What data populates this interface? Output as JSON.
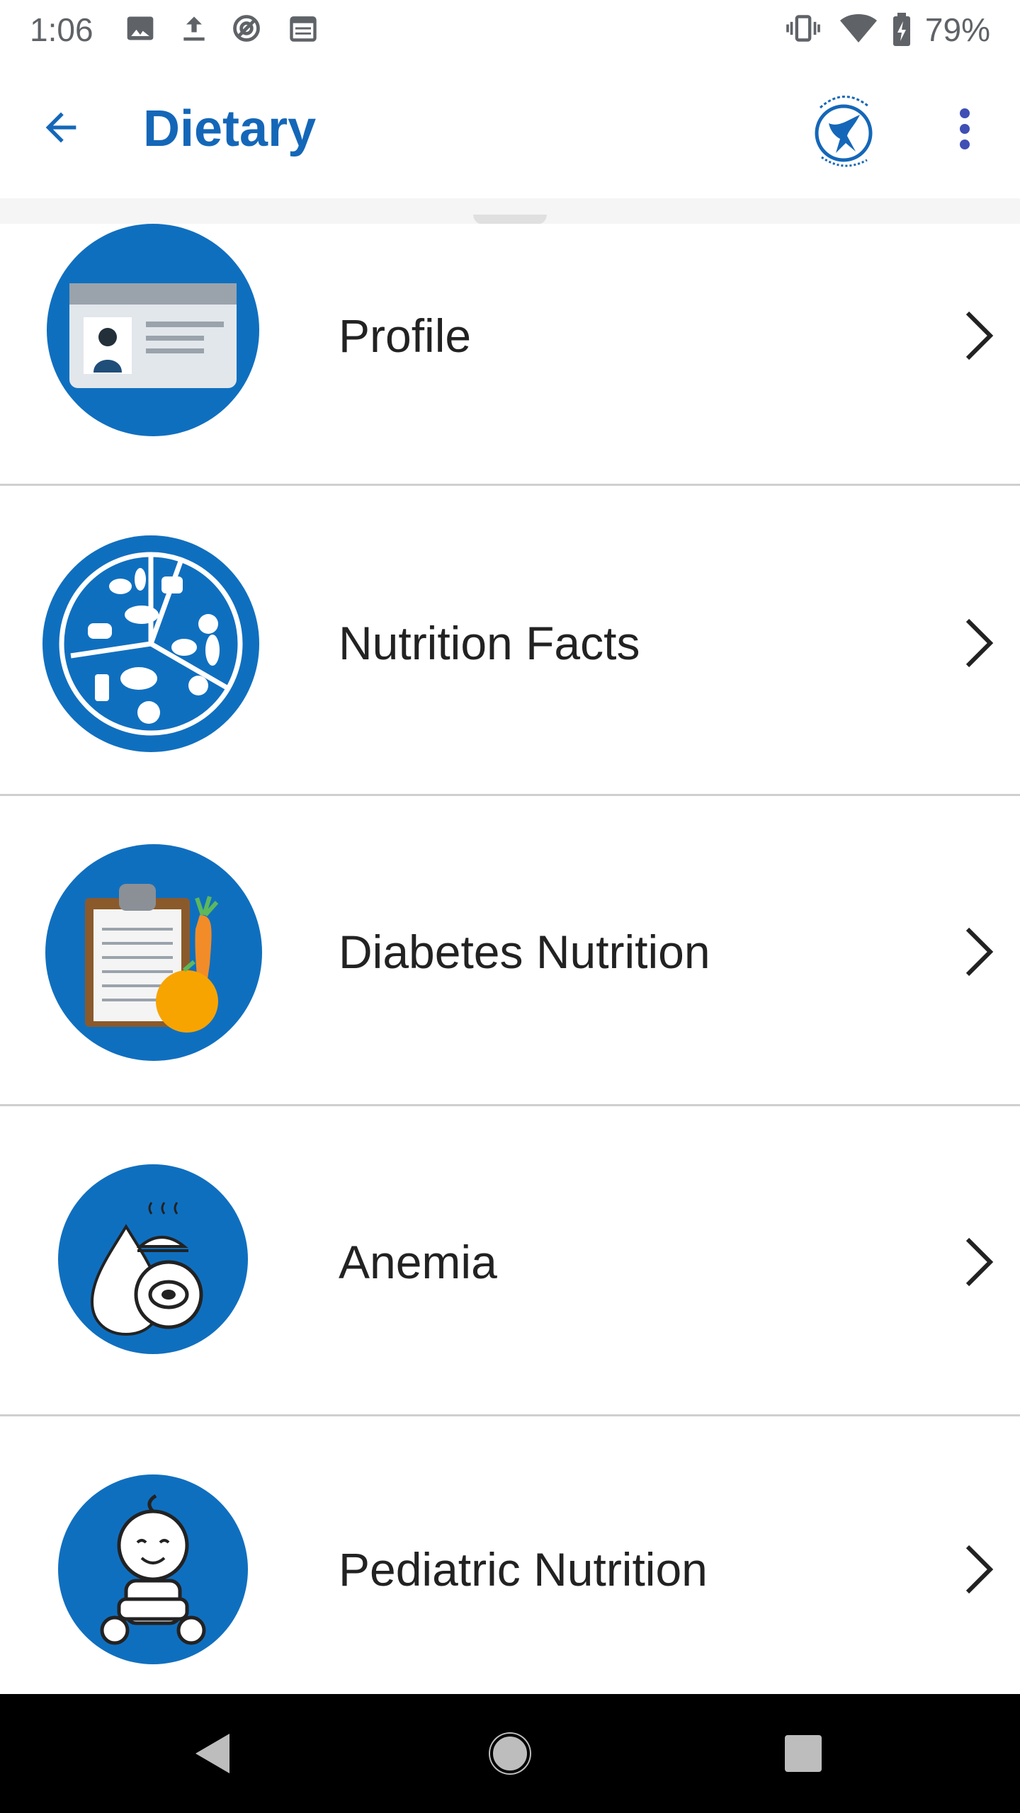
{
  "status_bar": {
    "time": "1:06",
    "battery_percent": "79%",
    "icons": [
      "image-icon",
      "upload-icon",
      "sync-icon",
      "calendar-icon",
      "vibrate-icon",
      "wifi-icon",
      "battery-charging-icon"
    ]
  },
  "app_bar": {
    "title": "Dietary",
    "back_icon": "arrow-left-icon",
    "logo": "kuwait-oil-company-logo",
    "menu_icon": "more-vertical-icon"
  },
  "list": {
    "items": [
      {
        "label": "Profile",
        "icon": "id-card-icon"
      },
      {
        "label": "Nutrition Facts",
        "icon": "food-plate-icon"
      },
      {
        "label": "Diabetes Nutrition",
        "icon": "clipboard-fruit-icon"
      },
      {
        "label": "Anemia",
        "icon": "blood-drop-meat-icon"
      },
      {
        "label": "Pediatric Nutrition",
        "icon": "baby-icon"
      }
    ]
  },
  "colors": {
    "accent": "#1467b8",
    "icon_circle": "#0f6fbf",
    "divider": "#cfcfcf",
    "text": "#222222",
    "nav_bar": "#000000"
  },
  "nav_bar": {
    "icons": [
      "back-triangle-icon",
      "home-circle-icon",
      "recents-square-icon"
    ]
  }
}
